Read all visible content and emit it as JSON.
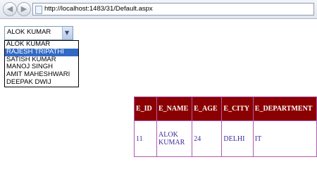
{
  "browser": {
    "address": "http://localhost:1483/31/Default.aspx",
    "back_icon": "back-arrow-icon",
    "forward_icon": "forward-arrow-icon"
  },
  "employee_select": {
    "selected_value": "ALOK KUMAR",
    "options": [
      "ALOK KUMAR",
      "RAJESH TRIPATHI",
      "SATISH KUMAR",
      "MANOJ SINGH",
      "AMIT MAHESHWARI",
      "DEEPAK DWIJ"
    ],
    "highlighted_option": "RAJESH TRIPATHI"
  },
  "grid": {
    "headers": [
      "E_ID",
      "E_NAME",
      "E_AGE",
      "E_CITY",
      "E_DEPARTMENT"
    ],
    "rows": [
      [
        "11",
        "ALOK KUMAR",
        "24",
        "DELHI",
        "IT"
      ]
    ],
    "header_bg": "#8b0000",
    "cell_text_color": "#3a2a99",
    "border_color": "#b05ab0"
  }
}
